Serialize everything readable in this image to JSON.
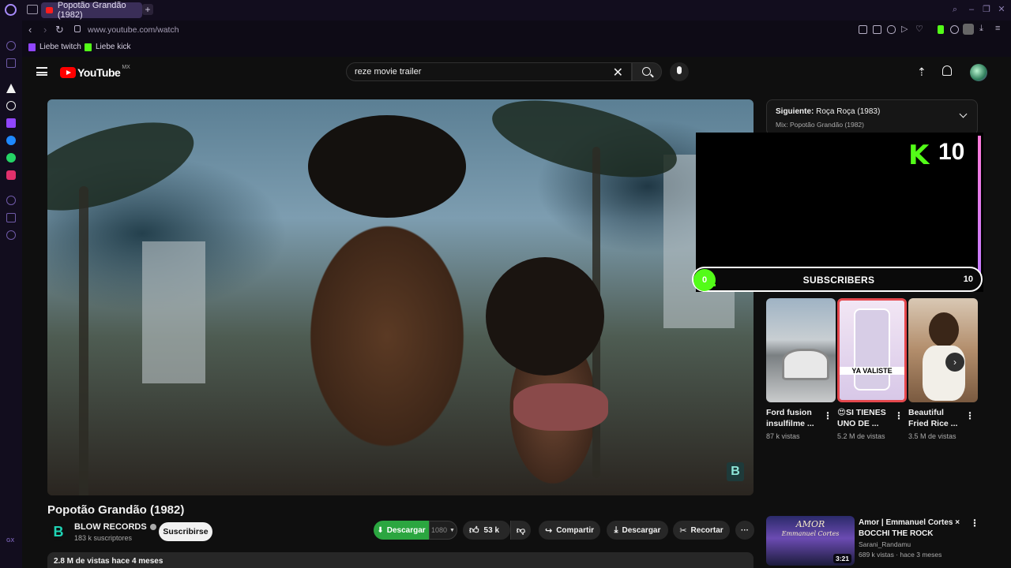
{
  "browser": {
    "tab_title": "Popotão Grandão (1982)",
    "new_tab": "+",
    "url": "www.youtube.com/watch",
    "bookmarks": [
      {
        "label": "Liebe twitch",
        "color": "#9146ff"
      },
      {
        "label": "Liebe kick",
        "color": "#53fc18"
      }
    ],
    "sidebar_label": "GX"
  },
  "youtube": {
    "logo": "YouTube",
    "region": "MX",
    "search": {
      "value": "reze movie trailer",
      "clear_icon": "close-icon"
    },
    "video": {
      "title": "Popotão Grandão (1982)",
      "channel": "BLOW RECORDS",
      "channel_initial": "B",
      "subscribers": "183 k suscriptores",
      "subscribe_label": "Suscribirse",
      "download_label": "Descargar",
      "quality": "1080",
      "likes": "53 k",
      "share_label": "Compartir",
      "download2_label": "Descargar",
      "clip_label": "Recortar",
      "more": "···",
      "stats": "2.8 M de vistas  hace 4 meses"
    },
    "up_next": {
      "prefix": "Siguiente:",
      "title": "Roça Roça (1983)",
      "mix": "Mix: Popotão Grandão (1982)"
    },
    "kick_overlay": {
      "count": "10",
      "progress_current": "0",
      "progress_label": "SUBSCRIBERS",
      "progress_goal": "10",
      "progress_fraction": 0.0
    },
    "shorts": [
      {
        "title": "Ford fusion insulfilme ...",
        "views": "87 k vistas"
      },
      {
        "title": "😍SI TIENES UNO DE ...",
        "views": "5.2 M de vistas",
        "overlay_text": "YA VALISTE"
      },
      {
        "title": "Beautiful Fried Rice ...",
        "views": "3.5 M de vistas"
      }
    ],
    "recommended": [
      {
        "title": "Amor | Emmanuel Cortes × BOCCHI THE ROCK",
        "channel": "Sarani_Randamu",
        "meta": "689 k vistas · hace 3 meses",
        "duration": "3:21",
        "thumb_text": "AMOR",
        "thumb_sub": "Emmanuel Cortes"
      }
    ]
  }
}
